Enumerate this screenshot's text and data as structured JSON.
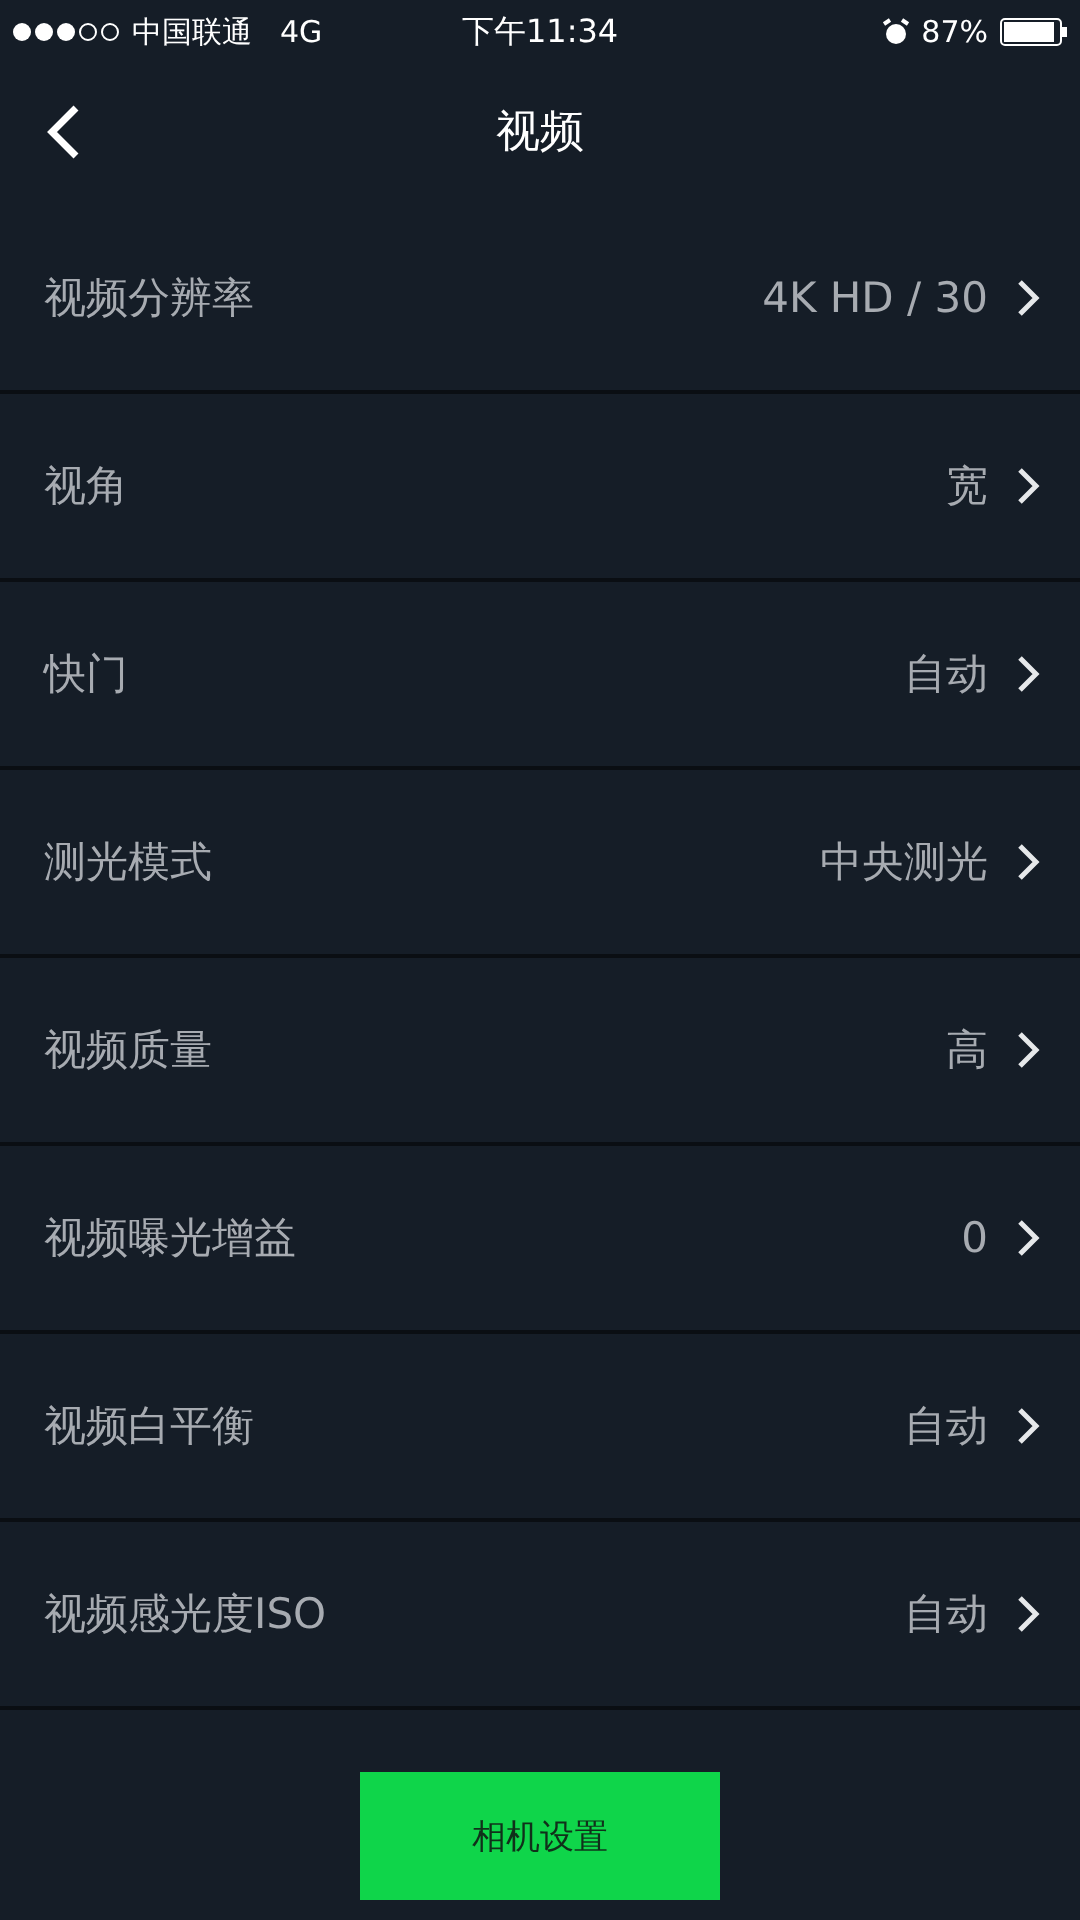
{
  "status_bar": {
    "carrier": "中国联通",
    "network": "4G",
    "time": "下午11:34",
    "battery": "87%"
  },
  "header": {
    "title": "视频"
  },
  "settings": [
    {
      "label": "视频分辨率",
      "value": "4K HD / 30"
    },
    {
      "label": "视角",
      "value": "宽"
    },
    {
      "label": "快门",
      "value": "自动"
    },
    {
      "label": "测光模式",
      "value": "中央测光"
    },
    {
      "label": "视频质量",
      "value": "高"
    },
    {
      "label": "视频曝光增益",
      "value": "0"
    },
    {
      "label": "视频白平衡",
      "value": "自动"
    },
    {
      "label": "视频感光度ISO",
      "value": "自动"
    }
  ],
  "button": {
    "label": "相机设置"
  }
}
